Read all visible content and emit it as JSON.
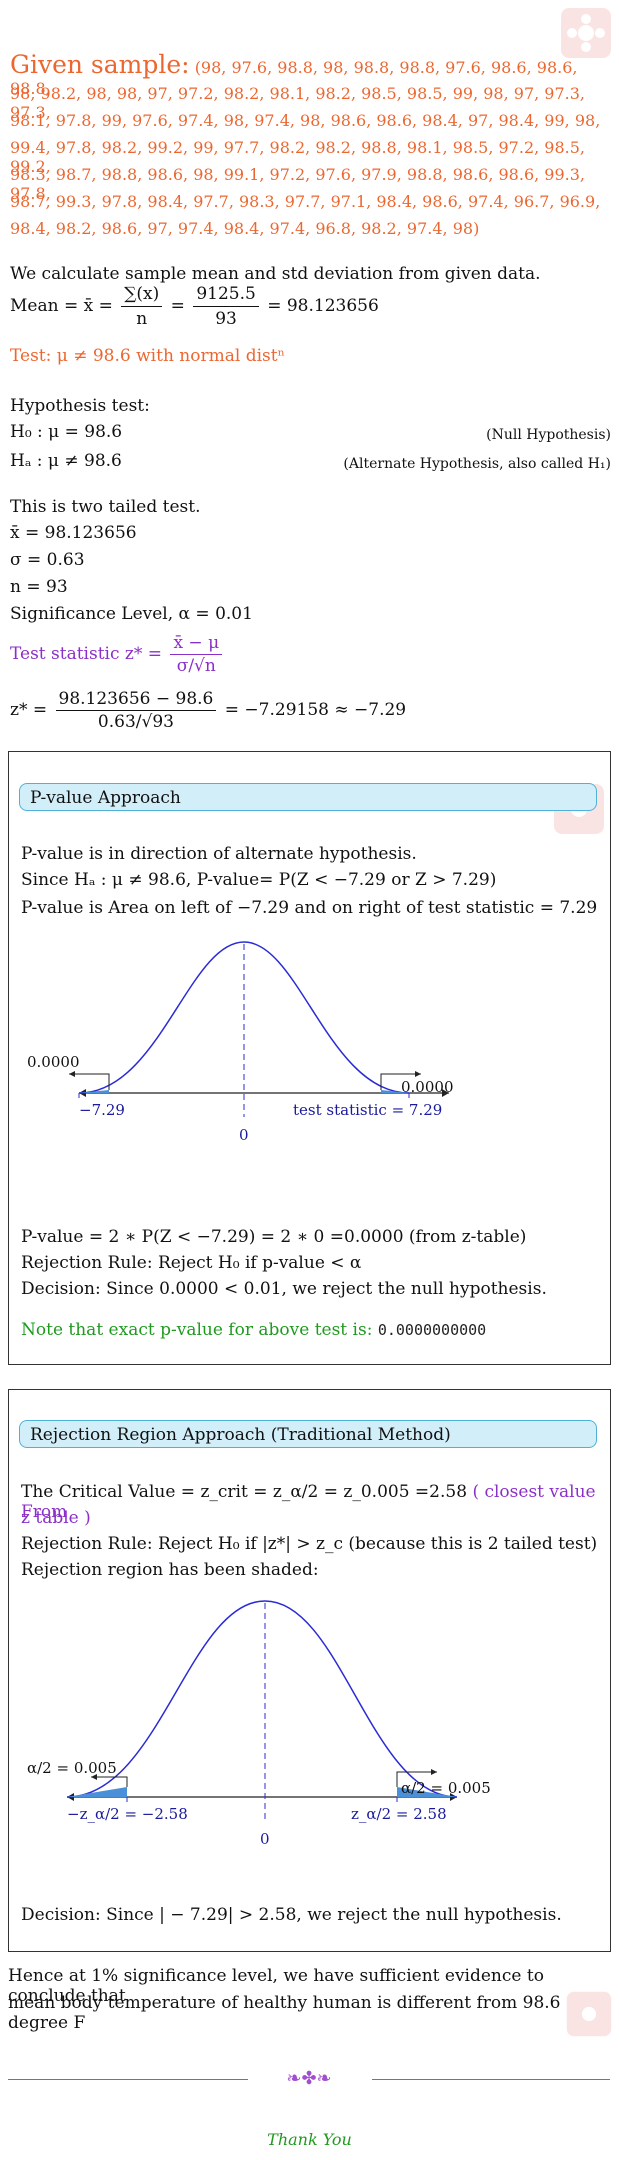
{
  "sample": {
    "heading": "Given sample:",
    "lines": [
      "(98, 97.6, 98.8, 98, 98.8, 98.8, 97.6, 98.6, 98.6, 98.8,",
      "98, 98.2, 98, 98, 97, 97.2, 98.2, 98.1, 98.2, 98.5, 98.5, 99, 98, 97, 97.3, 97.3,",
      "98.1, 97.8, 99, 97.6, 97.4, 98, 97.4, 98, 98.6, 98.6, 98.4, 97, 98.4, 99, 98,",
      "99.4, 97.8, 98.2, 99.2, 99, 97.7, 98.2, 98.2, 98.8, 98.1, 98.5, 97.2, 98.5, 99.2,",
      "98.3, 98.7, 98.8, 98.6, 98, 99.1, 97.2, 97.6, 97.9, 98.8, 98.6, 98.6, 99.3, 97.8,",
      "98.7, 99.3, 97.8, 98.4, 97.7, 98.3, 97.7, 97.1, 98.4, 98.6, 97.4, 96.7, 96.9,",
      "98.4, 98.2, 98.6, 97, 97.4, 98.4, 97.4, 96.8, 98.2, 97.4, 98)"
    ]
  },
  "calc": {
    "intro": "We calculate sample mean and std deviation from given data.",
    "mean_label": "Mean = x̄ =",
    "mean_num": "∑(x)",
    "mean_den": "n",
    "eq1": "=",
    "sum_num": "9125.5",
    "sum_den": "93",
    "result": "= 98.123656"
  },
  "test_heading": "Test: μ ≠ 98.6 with normal distⁿ",
  "hypothesis": {
    "title": "Hypothesis test:",
    "h0": "H₀ : μ = 98.6",
    "h0_note": "(Null Hypothesis)",
    "ha": "Hₐ : μ ≠ 98.6",
    "ha_note": "(Alternate Hypothesis, also called H₁)"
  },
  "params": {
    "tail": "This is two tailed test.",
    "xbar": "x̄ = 98.123656",
    "sigma": "σ = 0.63",
    "n": "n = 93",
    "alpha": "Significance Level, α = 0.01",
    "ts_label": "Test statistic z* =",
    "ts_num": "x̄ − μ",
    "ts_den": "σ/√n",
    "z_label": "z* =",
    "z_num": "98.123656 − 98.6",
    "z_den": "0.63/√93",
    "z_result": "= −7.29158 ≈ −7.29"
  },
  "pvalue": {
    "title": "P-value Approach",
    "l1": "P-value is in direction of alternate hypothesis.",
    "l2": "Since Hₐ : μ ≠ 98.6, P-value= P(Z < −7.29 or Z > 7.29)",
    "l3": "P-value is Area on left of −7.29 and on right of test statistic = 7.29",
    "graph": {
      "left_area": "0.0000",
      "right_area": "0.0000",
      "left_label": "−7.29",
      "center_label": "0",
      "right_label": "test statistic = 7.29"
    },
    "r1": "P-value = 2 ∗ P(Z < −7.29) = 2 ∗ 0 =0.0000 (from z-table)",
    "r2": "Rejection Rule: Reject H₀ if p-value < α",
    "r3": "Decision: Since 0.0000 < 0.01, we reject the null hypothesis.",
    "note": "Note that exact p-value for above test is:",
    "exact": "0.0000000000"
  },
  "rejection": {
    "title": "Rejection Region Approach (Traditional Method)",
    "l1": "The Critical Value = z_crit = z_α/2 = z_0.005 =2.58",
    "l1b": "( closest value From",
    "l1c": "z table )",
    "l2": "Rejection Rule: Reject H₀ if |z*| > z_c (because this is 2 tailed test)",
    "l3": "Rejection region has been shaded:",
    "graph": {
      "left_area": "α/2 = 0.005",
      "right_area": "α/2 = 0.005",
      "left_label": "−z_α/2 = −2.58",
      "center_label": "0",
      "right_label": "z_α/2 = 2.58"
    },
    "decision": "Decision: Since | − 7.29| > 2.58, we reject the null hypothesis."
  },
  "conclusion": {
    "l1": "Hence at 1% significance level, we have sufficient evidence to conclude that",
    "l2": "mean body temperature of healthy human is different from 98.6 degree F"
  },
  "divider_ornament": "❧✤❧",
  "thanks": "Thank You",
  "colors": {
    "heading": "#ec6730",
    "purple": "#8b2fc9",
    "green": "#1f9a1f",
    "curve": "#2b2bd6",
    "shade": "#4a90d9",
    "pill_bg": "#d2eef9",
    "pill_border": "#4fb1d8"
  }
}
